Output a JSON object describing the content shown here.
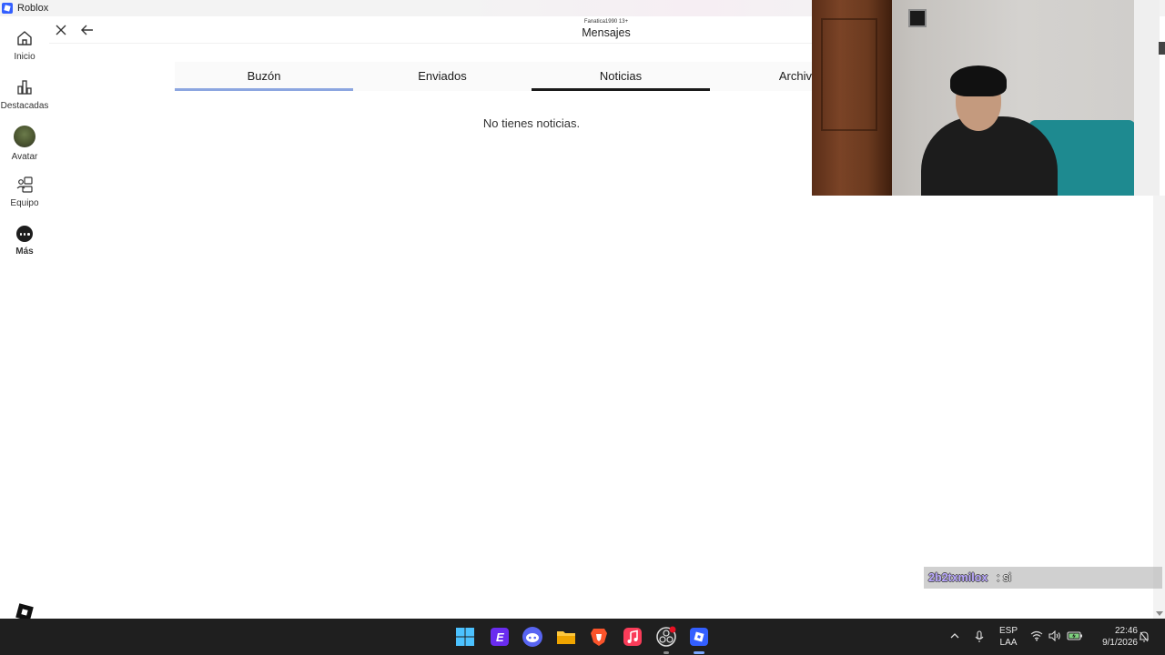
{
  "window": {
    "title": "Roblox"
  },
  "nav": {
    "items": [
      {
        "label": "Inicio",
        "icon": "home-icon"
      },
      {
        "label": "Destacadas",
        "icon": "charts-icon"
      },
      {
        "label": "Avatar",
        "icon": "avatar-icon"
      },
      {
        "label": "Equipo",
        "icon": "team-icon"
      },
      {
        "label": "Más",
        "icon": "more-icon"
      }
    ]
  },
  "header": {
    "subtitle": "Fanatica1990 13+",
    "title": "Mensajes"
  },
  "tabs": [
    {
      "label": "Buzón"
    },
    {
      "label": "Enviados"
    },
    {
      "label": "Noticias",
      "active": true
    },
    {
      "label": "Archiv"
    }
  ],
  "main": {
    "empty_message": "No tienes noticias."
  },
  "chat": {
    "user": "2b2txmilox",
    "message": ": si",
    "user_color": "#b9a7ff"
  },
  "taskbar": {
    "apps": [
      "windows-start",
      "epic-games",
      "discord",
      "file-explorer",
      "brave",
      "apple-music",
      "obs-studio",
      "roblox"
    ],
    "language": {
      "line1": "ESP",
      "line2": "LAA"
    },
    "time": "22:46",
    "date": "9/1/2026"
  },
  "colors": {
    "inbox_tab_underline": "#8ca6e0",
    "active_tab_underline": "#1a1a1a",
    "taskbar_bg": "#1f1f1f",
    "roblox_blue": "#335fff"
  }
}
